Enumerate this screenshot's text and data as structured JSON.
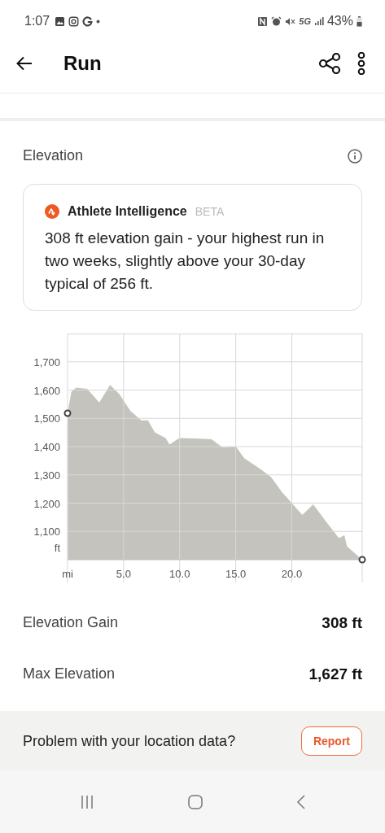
{
  "status_bar": {
    "time": "1:07",
    "network": "5G",
    "battery": "43%"
  },
  "header": {
    "title": "Run"
  },
  "section": {
    "title": "Elevation"
  },
  "insight": {
    "title": "Athlete Intelligence",
    "badge": "BETA",
    "text": "308 ft elevation gain - your highest run in two weeks, slightly above your 30-day typical of 256 ft."
  },
  "chart_data": {
    "type": "area",
    "ylabel": "ft",
    "grid": true,
    "x": [
      0,
      0.34,
      0.77,
      1.74,
      2.83,
      3.79,
      4.64,
      5.6,
      6.57,
      7.17,
      7.78,
      8.74,
      9.1,
      9.95,
      11.4,
      12.85,
      13.82,
      15.02,
      15.75,
      17.2,
      18.16,
      19.13,
      20.1,
      20.94,
      21.91,
      22.99,
      24.2,
      24.69,
      24.93,
      26.28
    ],
    "series": [
      {
        "color": "#c4c3bd",
        "values": [
          1518,
          1594,
          1609,
          1604,
          1556,
          1618,
          1585,
          1527,
          1493,
          1493,
          1450,
          1430,
          1407,
          1430,
          1429,
          1426,
          1397,
          1400,
          1359,
          1321,
          1292,
          1239,
          1196,
          1158,
          1196,
          1138,
          1076,
          1086,
          1047,
          1000
        ]
      }
    ],
    "xlim": [
      0,
      26.28
    ],
    "ylim": [
      1000,
      1800
    ],
    "xticks": [
      {
        "value": 0,
        "label": "mi"
      },
      {
        "value": 5,
        "label": "5.0"
      },
      {
        "value": 10,
        "label": "10.0"
      },
      {
        "value": 15,
        "label": "15.0"
      },
      {
        "value": 20,
        "label": "20.0"
      }
    ],
    "yticks": [
      {
        "value": 1100,
        "label": "1,100"
      },
      {
        "value": 1200,
        "label": "1,200"
      },
      {
        "value": 1300,
        "label": "1,300"
      },
      {
        "value": 1400,
        "label": "1,400"
      },
      {
        "value": 1500,
        "label": "1,500"
      },
      {
        "value": 1600,
        "label": "1,600"
      },
      {
        "value": 1700,
        "label": "1,700"
      }
    ]
  },
  "stats": [
    {
      "label": "Elevation Gain",
      "value": "308 ft"
    },
    {
      "label": "Max Elevation",
      "value": "1,627 ft"
    }
  ],
  "footer": {
    "text": "Problem with your location data?",
    "button": "Report"
  }
}
